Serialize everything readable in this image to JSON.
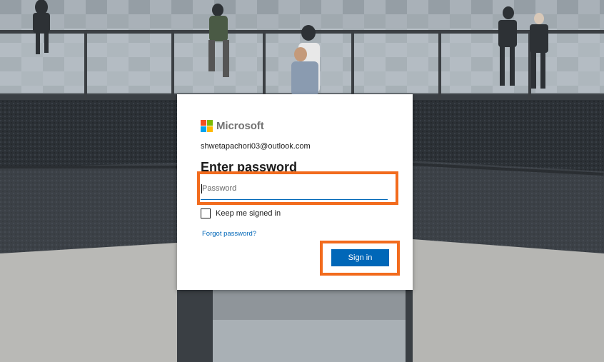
{
  "brand": {
    "name": "Microsoft",
    "colors": [
      "#f25022",
      "#7fba00",
      "#00a4ef",
      "#ffb900"
    ]
  },
  "login": {
    "identity": "shwetapachori03@outlook.com",
    "title": "Enter password",
    "password_placeholder": "Password",
    "password_value": "",
    "keep_signed_in_label": "Keep me signed in",
    "keep_signed_in_checked": false,
    "forgot_label": "Forgot password?",
    "signin_label": "Sign in"
  },
  "annotations": {
    "highlight_color": "#f26b1d"
  },
  "colors": {
    "accent": "#0067b8",
    "text": "#1b1b1b"
  }
}
